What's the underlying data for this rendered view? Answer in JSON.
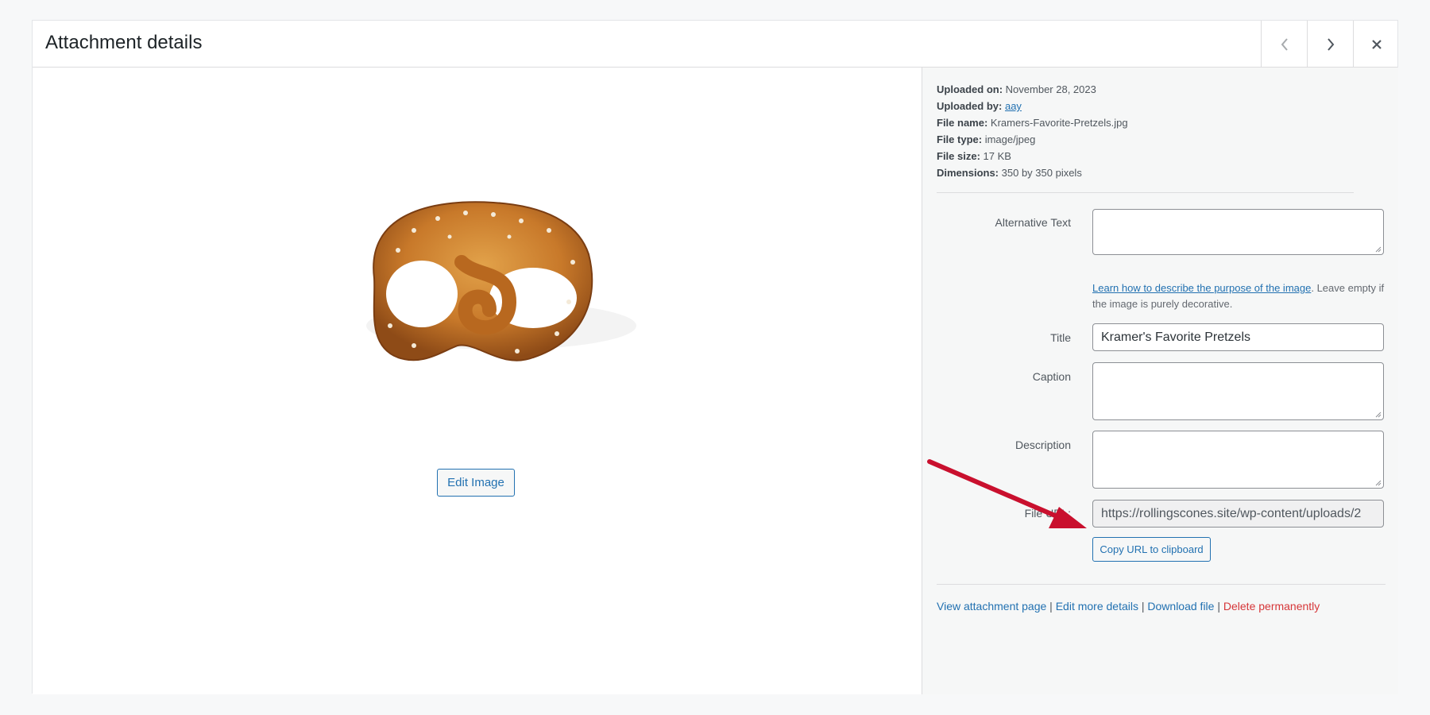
{
  "header": {
    "title": "Attachment details"
  },
  "preview": {
    "edit_button": "Edit Image"
  },
  "meta": {
    "uploaded_on_label": "Uploaded on:",
    "uploaded_on": "November 28, 2023",
    "uploaded_by_label": "Uploaded by:",
    "uploaded_by": "aay",
    "file_name_label": "File name:",
    "file_name": "Kramers-Favorite-Pretzels.jpg",
    "file_type_label": "File type:",
    "file_type": "image/jpeg",
    "file_size_label": "File size:",
    "file_size": "17 KB",
    "dimensions_label": "Dimensions:",
    "dimensions": "350 by 350 pixels"
  },
  "form": {
    "alt_label": "Alternative Text",
    "alt_value": "",
    "alt_help_link": "Learn how to describe the purpose of the image",
    "alt_help_text": ". Leave empty if the image is purely decorative.",
    "title_label": "Title",
    "title_value": "Kramer's Favorite Pretzels",
    "caption_label": "Caption",
    "caption_value": "",
    "description_label": "Description",
    "description_value": "",
    "file_url_label": "File URL:",
    "file_url_value": "https://rollingscones.site/wp-content/uploads/2",
    "copy_button": "Copy URL to clipboard"
  },
  "actions": {
    "view": "View attachment page",
    "edit": "Edit more details",
    "download": "Download file",
    "delete": "Delete permanently",
    "separator": "|"
  },
  "colors": {
    "accent": "#2271b1",
    "danger": "#d63638",
    "arrow": "#c9102e"
  },
  "icons": [
    "chevron-left-icon",
    "chevron-right-icon",
    "close-icon"
  ]
}
